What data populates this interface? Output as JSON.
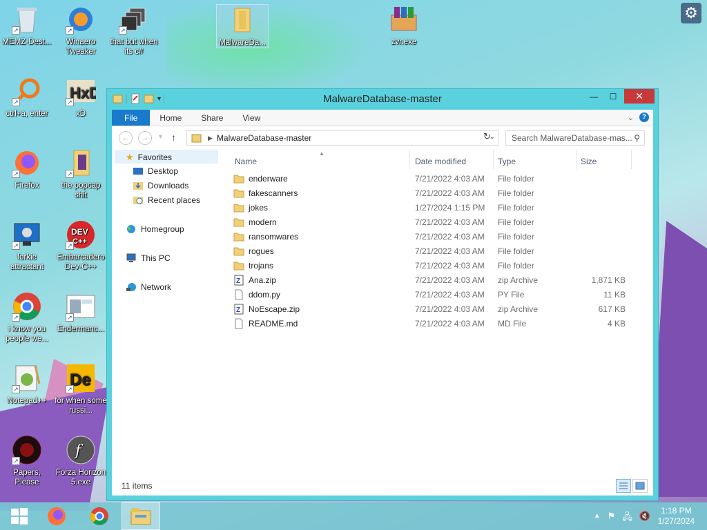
{
  "desktop": {
    "icons": [
      {
        "label": "MEMZ-Dest..."
      },
      {
        "label": "Winaero Tweaker"
      },
      {
        "label": "that but when its c#"
      },
      {
        "label": "MalwareDa..."
      },
      {
        "label": "zvr.exe"
      },
      {
        "label": "ctrl+a, enter"
      },
      {
        "label": "xD"
      },
      {
        "label": "Firefox"
      },
      {
        "label": "the popcap shit"
      },
      {
        "label": "forkie attractant"
      },
      {
        "label": "Embarcadero Dev-C++"
      },
      {
        "label": "i know you people we..."
      },
      {
        "label": "Endermanc..."
      },
      {
        "label": "Notepad++"
      },
      {
        "label": "for when some russi..."
      },
      {
        "label": "Papers, Please"
      },
      {
        "label": "Forza Horizon 5.exe"
      }
    ]
  },
  "window": {
    "title": "MalwareDatabase-master",
    "min": "—",
    "max": "☐",
    "close": "✕",
    "ribbon": {
      "tabs": [
        "File",
        "Home",
        "Share",
        "View"
      ]
    },
    "address": "MalwareDatabase-master",
    "search_placeholder": "Search MalwareDatabase-mas...",
    "nav_pane": {
      "favorites": "Favorites",
      "desktop": "Desktop",
      "downloads": "Downloads",
      "recent": "Recent places",
      "homegroup": "Homegroup",
      "thispc": "This PC",
      "network": "Network"
    },
    "columns": {
      "name": "Name",
      "date": "Date modified",
      "type": "Type",
      "size": "Size"
    },
    "files": [
      {
        "name": "enderware",
        "date": "7/21/2022 4:03 AM",
        "type": "File folder",
        "size": "",
        "icon": "folder"
      },
      {
        "name": "fakescanners",
        "date": "7/21/2022 4:03 AM",
        "type": "File folder",
        "size": "",
        "icon": "folder"
      },
      {
        "name": "jokes",
        "date": "1/27/2024 1:15 PM",
        "type": "File folder",
        "size": "",
        "icon": "folder"
      },
      {
        "name": "modern",
        "date": "7/21/2022 4:03 AM",
        "type": "File folder",
        "size": "",
        "icon": "folder"
      },
      {
        "name": "ransomwares",
        "date": "7/21/2022 4:03 AM",
        "type": "File folder",
        "size": "",
        "icon": "folder"
      },
      {
        "name": "rogues",
        "date": "7/21/2022 4:03 AM",
        "type": "File folder",
        "size": "",
        "icon": "folder"
      },
      {
        "name": "trojans",
        "date": "7/21/2022 4:03 AM",
        "type": "File folder",
        "size": "",
        "icon": "folder"
      },
      {
        "name": "Ana.zip",
        "date": "7/21/2022 4:03 AM",
        "type": "zip Archive",
        "size": "1,871 KB",
        "icon": "zip"
      },
      {
        "name": "ddom.py",
        "date": "7/21/2022 4:03 AM",
        "type": "PY File",
        "size": "11 KB",
        "icon": "file"
      },
      {
        "name": "NoEscape.zip",
        "date": "7/21/2022 4:03 AM",
        "type": "zip Archive",
        "size": "617 KB",
        "icon": "zip"
      },
      {
        "name": "README.md",
        "date": "7/21/2022 4:03 AM",
        "type": "MD File",
        "size": "4 KB",
        "icon": "file"
      }
    ],
    "status": "11 items"
  },
  "taskbar": {
    "time": "1:18 PM",
    "date": "1/27/2024"
  }
}
